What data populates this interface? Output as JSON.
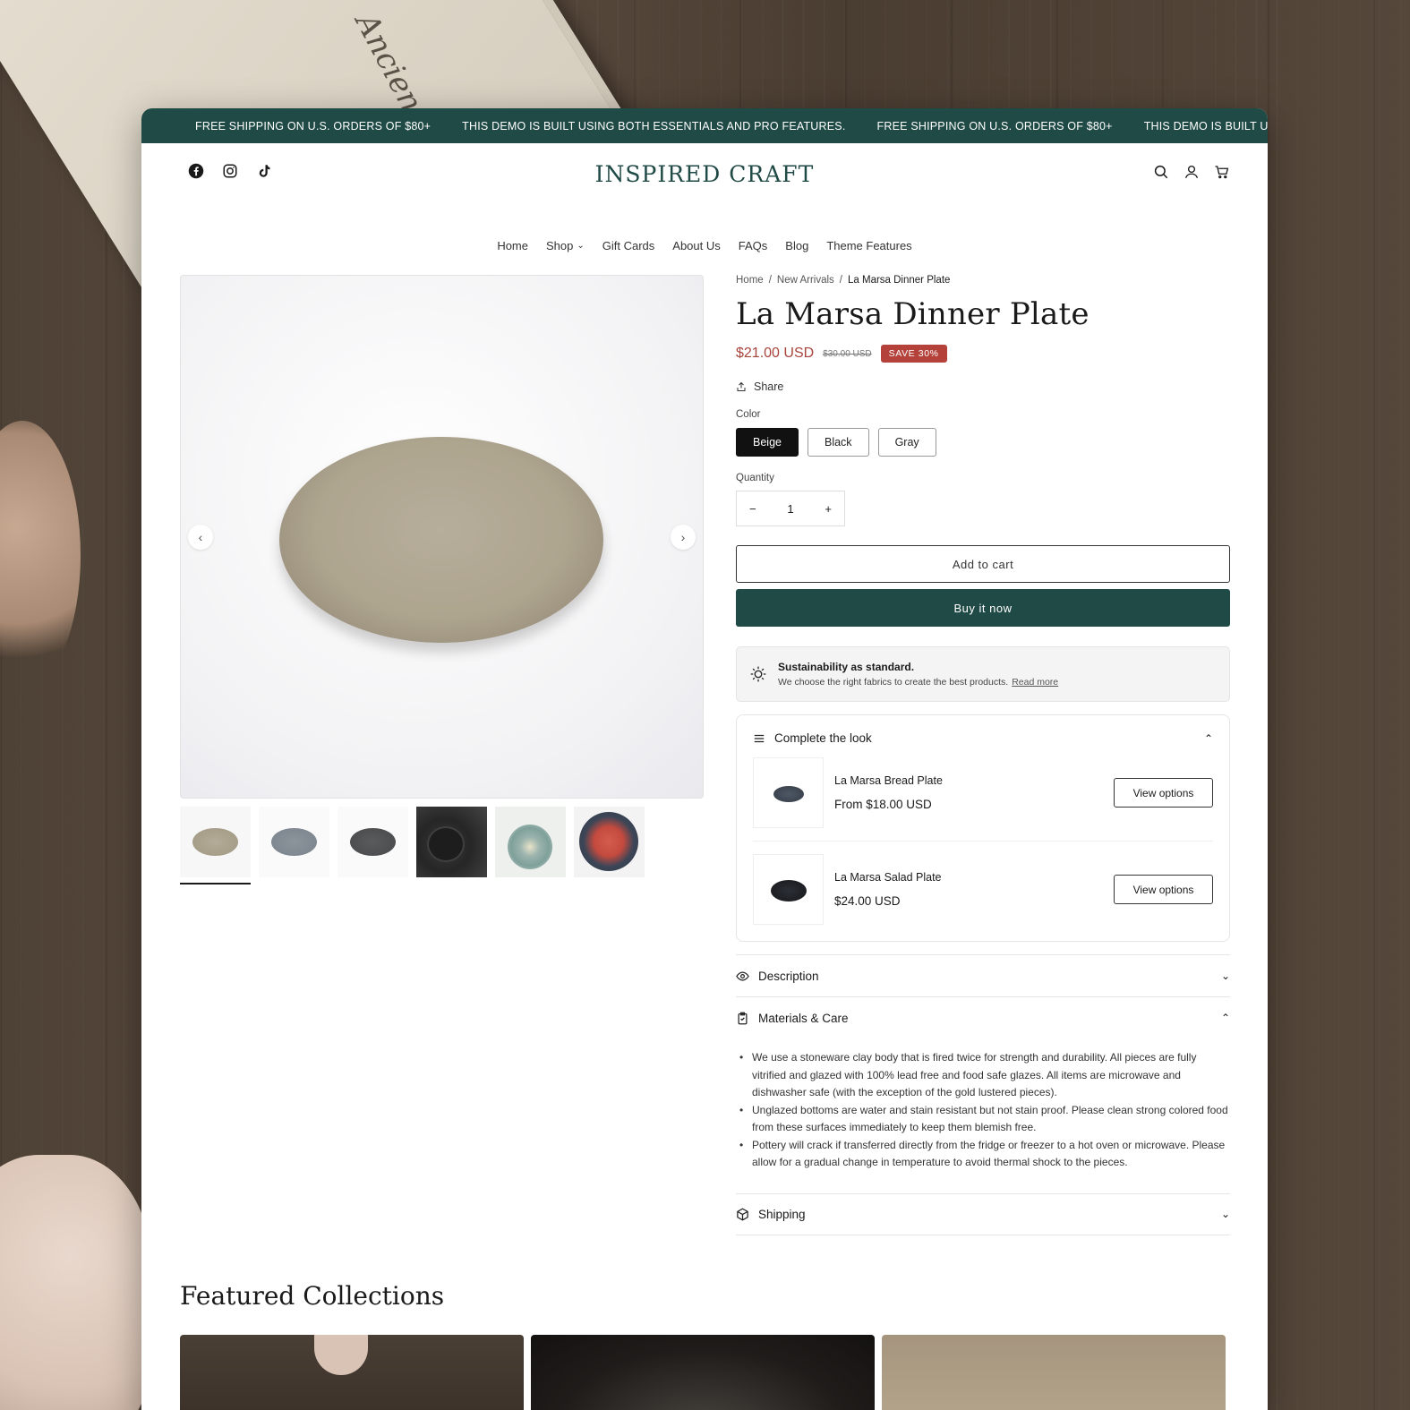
{
  "announcement": {
    "messages": [
      "FREE SHIPPING ON U.S. ORDERS OF $80+",
      "THIS DEMO IS BUILT USING BOTH ESSENTIALS AND PRO FEATURES.",
      "FREE SHIPPING ON U.S. ORDERS OF $80+",
      "THIS DEMO IS BUILT USING BOTH ESSENTIALS AND PRO FEATURES."
    ]
  },
  "header": {
    "logo": "INSPIRED CRAFT",
    "nav": [
      "Home",
      "Shop",
      "Gift Cards",
      "About Us",
      "FAQs",
      "Blog",
      "Theme Features"
    ]
  },
  "breadcrumb": {
    "home": "Home",
    "sep": "/",
    "category": "New Arrivals",
    "current": "La Marsa Dinner Plate"
  },
  "product": {
    "title": "La Marsa Dinner Plate",
    "price": "$21.00 USD",
    "compare_price": "$30.00 USD",
    "badge": "SAVE 30%",
    "share": "Share",
    "color_label": "Color",
    "colors": [
      "Beige",
      "Black",
      "Gray"
    ],
    "selected_color": "Beige",
    "quantity_label": "Quantity",
    "quantity": "1",
    "minus": "−",
    "plus": "+",
    "add_to_cart": "Add to cart",
    "buy_now": "Buy it now"
  },
  "sustainability": {
    "title": "Sustainability as standard.",
    "text": "We choose the right fabrics to create the best products.",
    "link": "Read more"
  },
  "complete_look": {
    "title": "Complete the look",
    "items": [
      {
        "name": "La Marsa Bread Plate",
        "price": "From $18.00 USD",
        "button": "View options"
      },
      {
        "name": "La Marsa Salad Plate",
        "price": "$24.00 USD",
        "button": "View options"
      }
    ]
  },
  "accordions": {
    "description": "Description",
    "materials": "Materials & Care",
    "materials_points": [
      "We use a stoneware clay body that is fired twice for strength and durability. All pieces are fully vitrified and glazed with 100% lead free and food safe glazes. All items are microwave and dishwasher safe (with the exception of the gold lustered pieces).",
      "Unglazed bottoms are water and stain resistant but not stain proof. Please clean strong colored food from these surfaces immediately to keep them blemish free.",
      "Pottery will crack if transferred directly from the fridge or freezer to a hot oven or microwave. Please allow for a gradual change in temperature to avoid thermal shock to the pieces."
    ],
    "shipping": "Shipping"
  },
  "featured": {
    "title": "Featured Collections"
  },
  "colors": {
    "brand_green": "#1f4a46",
    "sale_red": "#b4423b",
    "price_red": "#a8443c"
  }
}
